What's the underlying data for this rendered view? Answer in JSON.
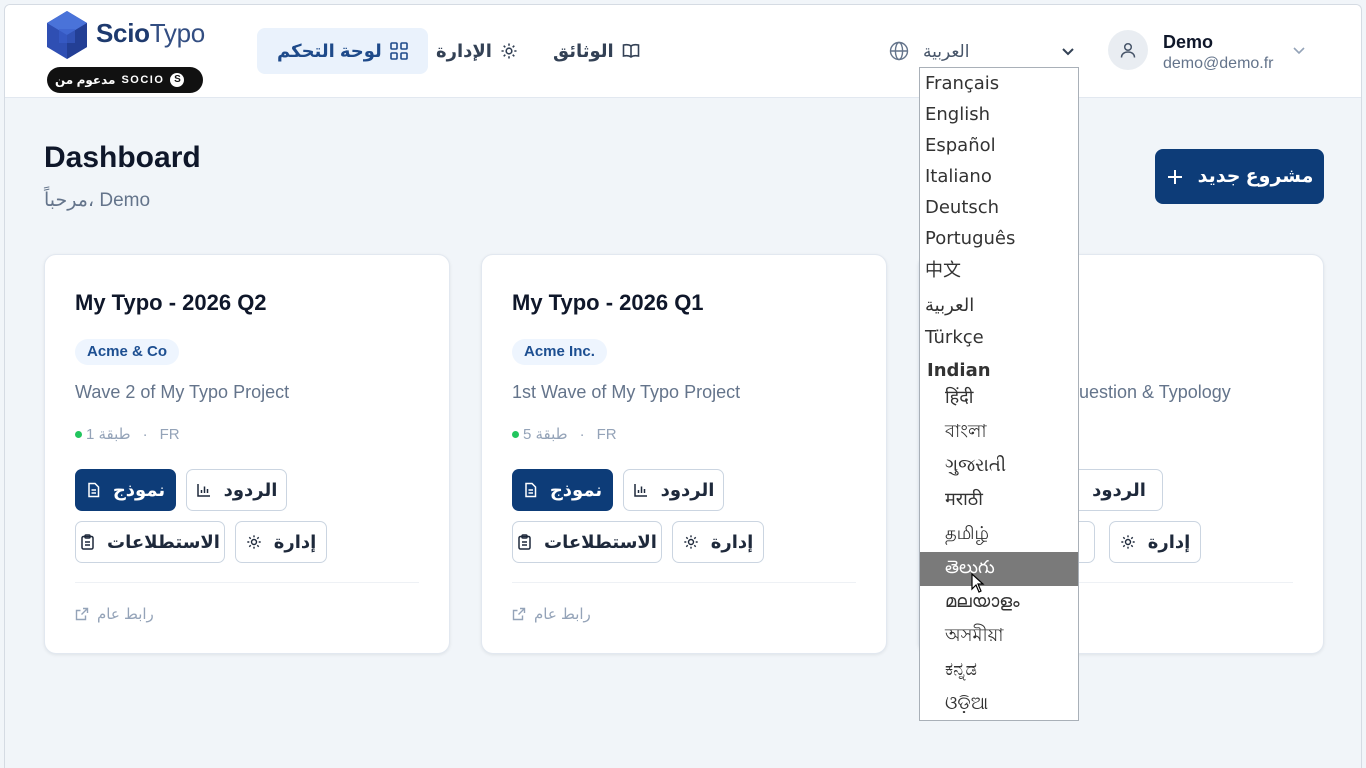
{
  "brand": {
    "name_bold": "Scio",
    "name_light": "Typo",
    "badge_arabic": "مدعوم من",
    "badge_socio": "SOCIO"
  },
  "nav": [
    {
      "label": "لوحة التحكم",
      "icon": "grid-icon",
      "active": true
    },
    {
      "label": "الإدارة",
      "icon": "gear-icon",
      "active": false
    },
    {
      "label": "الوثائق",
      "icon": "book-icon",
      "active": false
    }
  ],
  "language": {
    "current": "العربية"
  },
  "user": {
    "name": "Demo",
    "email": "demo@demo.fr"
  },
  "page": {
    "title": "Dashboard",
    "subtitle": "مرحباً، Demo",
    "new_project": "مشروع جديد"
  },
  "cards": [
    {
      "title": "My Typo - 2026 Q2",
      "org": "Acme & Co",
      "description": "Wave 2 of My Typo Project",
      "layers": "1 طبقة",
      "lang": "FR",
      "btn_form": "نموذج",
      "btn_responses": "الردود",
      "btn_surveys": "الاستطلاعات",
      "btn_manage": "إدارة",
      "public_link": "رابط عام"
    },
    {
      "title": "My Typo - 2026 Q1",
      "org": "Acme Inc.",
      "description": "1st Wave of My Typo Project",
      "layers": "5 طبقة",
      "lang": "FR",
      "btn_form": "نموذج",
      "btn_responses": "الردود",
      "btn_surveys": "الاستطلاعات",
      "btn_manage": "إدارة",
      "public_link": "رابط عام"
    },
    {
      "title": "",
      "org": "",
      "description": "uestion & Typology",
      "layers": "",
      "lang": "",
      "btn_form": "",
      "btn_responses": "الردود",
      "btn_surveys": "",
      "btn_manage": "إدارة",
      "public_link": ""
    }
  ],
  "dropdown": {
    "options": [
      "Français",
      "English",
      "Español",
      "Italiano",
      "Deutsch",
      "Português",
      "中文",
      "العربية",
      "Türkçe"
    ],
    "group_label": "Indian",
    "indian_options": [
      "हिंदी",
      "বাংলা",
      "ગુજરાતી",
      "मराठी",
      "தமிழ்",
      "తెలుగు",
      "മലയാളം",
      "অসমীয়া",
      "ಕನ್ನಡ",
      "ଓଡ଼ିଆ"
    ],
    "highlighted": "తెలుగు"
  },
  "colors": {
    "primary": "#0d3c78",
    "active_nav_bg": "#eaf2fc",
    "badge_bg": "#eef5fe",
    "success": "#22c55e",
    "highlight": "#7a7a7a"
  }
}
